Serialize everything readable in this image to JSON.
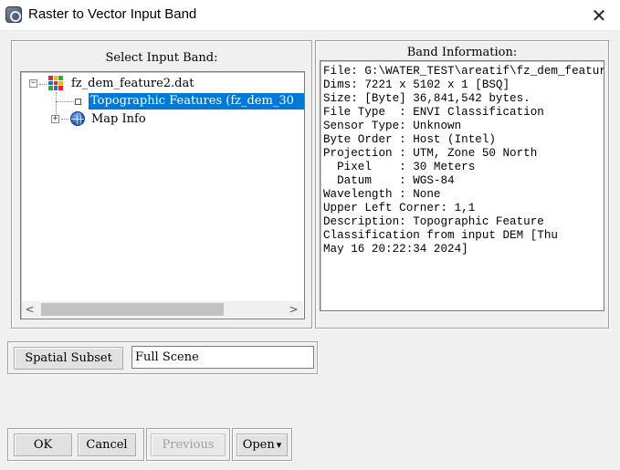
{
  "window": {
    "title": "Raster to Vector Input Band",
    "close_glyph": "✕"
  },
  "select_panel": {
    "title": "Select Input Band:",
    "tree": {
      "file": "fz_dem_feature2.dat",
      "band": "Topographic Features (fz_dem_30",
      "map_info": "Map Info",
      "expander_minus": "−",
      "expander_plus": "+"
    },
    "scroll_left": "<",
    "scroll_right": ">"
  },
  "info_panel": {
    "title": "Band Information:",
    "lines": [
      "File: G:\\WATER_TEST\\areatif\\fz_dem_featur",
      "Dims: 7221 x 5102 x 1 [BSQ]",
      "Size: [Byte] 36,841,542 bytes.",
      "File Type  : ENVI Classification",
      "Sensor Type: Unknown",
      "Byte Order : Host (Intel)",
      "Projection : UTM, Zone 50 North",
      "  Pixel    : 30 Meters",
      "  Datum    : WGS-84",
      "Wavelength : None",
      "Upper Left Corner: 1,1",
      "Description: Topographic Feature",
      "Classification from input DEM [Thu",
      "May 16 20:22:34 2024]"
    ]
  },
  "subset": {
    "button_label": "Spatial Subset",
    "value": "Full Scene"
  },
  "buttons": {
    "ok": "OK",
    "cancel": "Cancel",
    "previous": "Previous",
    "open": "Open",
    "open_arrow": "▾"
  },
  "icons": {
    "app": "app-window-icon",
    "file": "raster-file-icon",
    "band": "band-box-icon",
    "map_info": "globe-icon"
  }
}
